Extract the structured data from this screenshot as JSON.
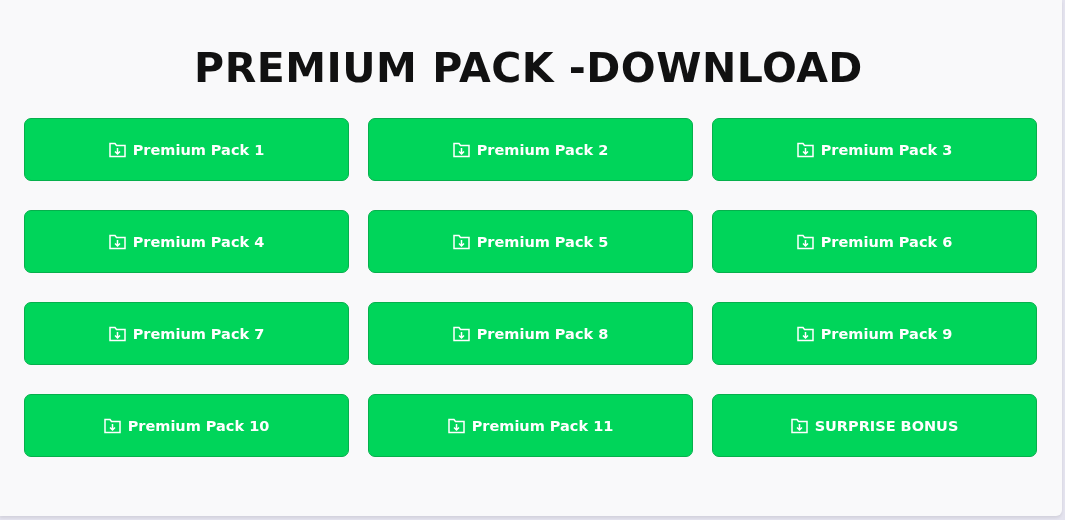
{
  "title": "PREMIUM PACK -DOWNLOAD",
  "buttons": [
    {
      "label": "Premium Pack 1"
    },
    {
      "label": "Premium Pack 2"
    },
    {
      "label": "Premium Pack 3"
    },
    {
      "label": "Premium Pack 4"
    },
    {
      "label": "Premium Pack 5"
    },
    {
      "label": "Premium Pack 6"
    },
    {
      "label": "Premium Pack 7"
    },
    {
      "label": "Premium Pack 8"
    },
    {
      "label": "Premium Pack 9"
    },
    {
      "label": "Premium Pack 10"
    },
    {
      "label": "Premium Pack 11"
    },
    {
      "label": "SURPRISE BONUS"
    }
  ]
}
